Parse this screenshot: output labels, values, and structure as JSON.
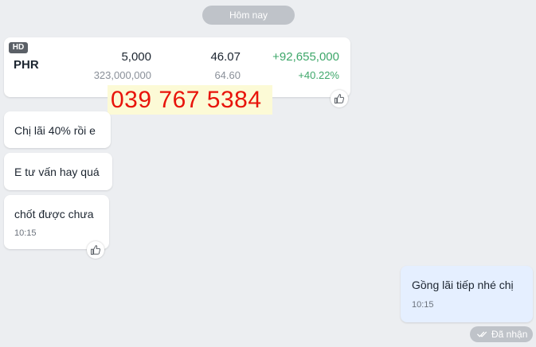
{
  "date_divider": "Hôm nay",
  "stock_card": {
    "badge": "HD",
    "ticker": "PHR",
    "price": "5,000",
    "current": "46.07",
    "profit": "+92,655,000",
    "volume": "323,000,000",
    "cost": "64.60",
    "profit_pct": "+40.22%"
  },
  "phone_overlay": "039 767 5384",
  "messages": [
    {
      "text": "Chị lãi 40% rồi e"
    },
    {
      "text": "E tư vấn hay quá"
    },
    {
      "text": "chốt được chưa",
      "time": "10:15"
    }
  ],
  "outgoing": {
    "text": "Gồng lãi tiếp nhé chị",
    "time": "10:15"
  },
  "status": "Đã nhận",
  "colors": {
    "background": "#ECEEF1",
    "profit_green": "#3EA76A",
    "overlay_red": "#E8140B",
    "outgoing_bubble": "#E5EFFF"
  },
  "icons": [
    "thumbs-up-icon",
    "double-check-icon"
  ]
}
